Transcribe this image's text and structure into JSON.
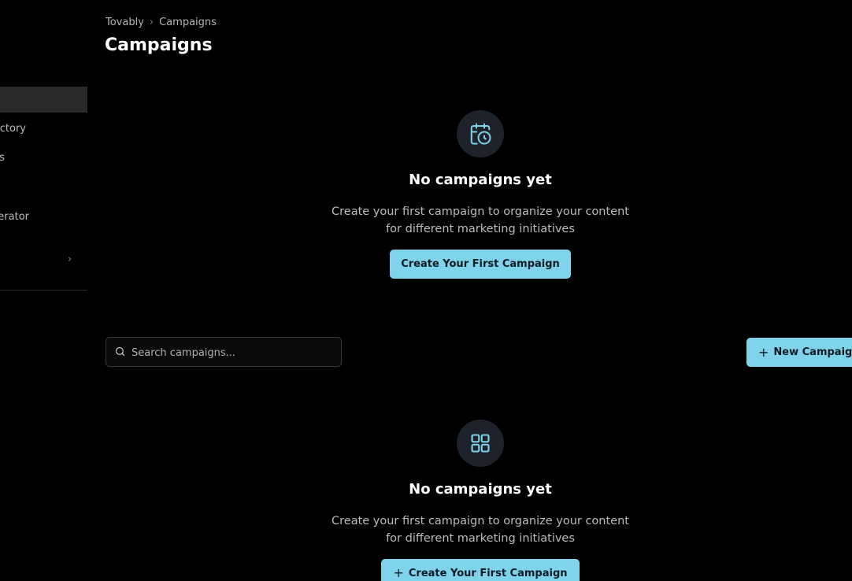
{
  "breadcrumb": {
    "root": "Tovably",
    "separator": "›",
    "current": "Campaigns"
  },
  "page_title": "Campaigns",
  "sidebar": {
    "items": [
      {
        "label": "actory"
      },
      {
        "label": "s"
      },
      {
        "label": "erator"
      }
    ],
    "chevron": "›"
  },
  "empty_state_top": {
    "icon": "calendar-clock-icon",
    "title": "No campaigns yet",
    "description": "Create your first campaign to organize your content for different marketing initiatives",
    "button_label": "Create Your First Campaign"
  },
  "search": {
    "placeholder": "Search campaigns...",
    "value": ""
  },
  "new_campaign_button": {
    "label": "New Campaign"
  },
  "empty_state_bottom": {
    "icon": "grid-icon",
    "title": "No campaigns yet",
    "description": "Create your first campaign to organize your content for different marketing initiatives",
    "button_label": "Create Your First Campaign"
  },
  "colors": {
    "background": "#000000",
    "accent": "#7fd3ea",
    "icon_circle": "#1e232b",
    "sidebar_active": "#2a2a2a"
  }
}
